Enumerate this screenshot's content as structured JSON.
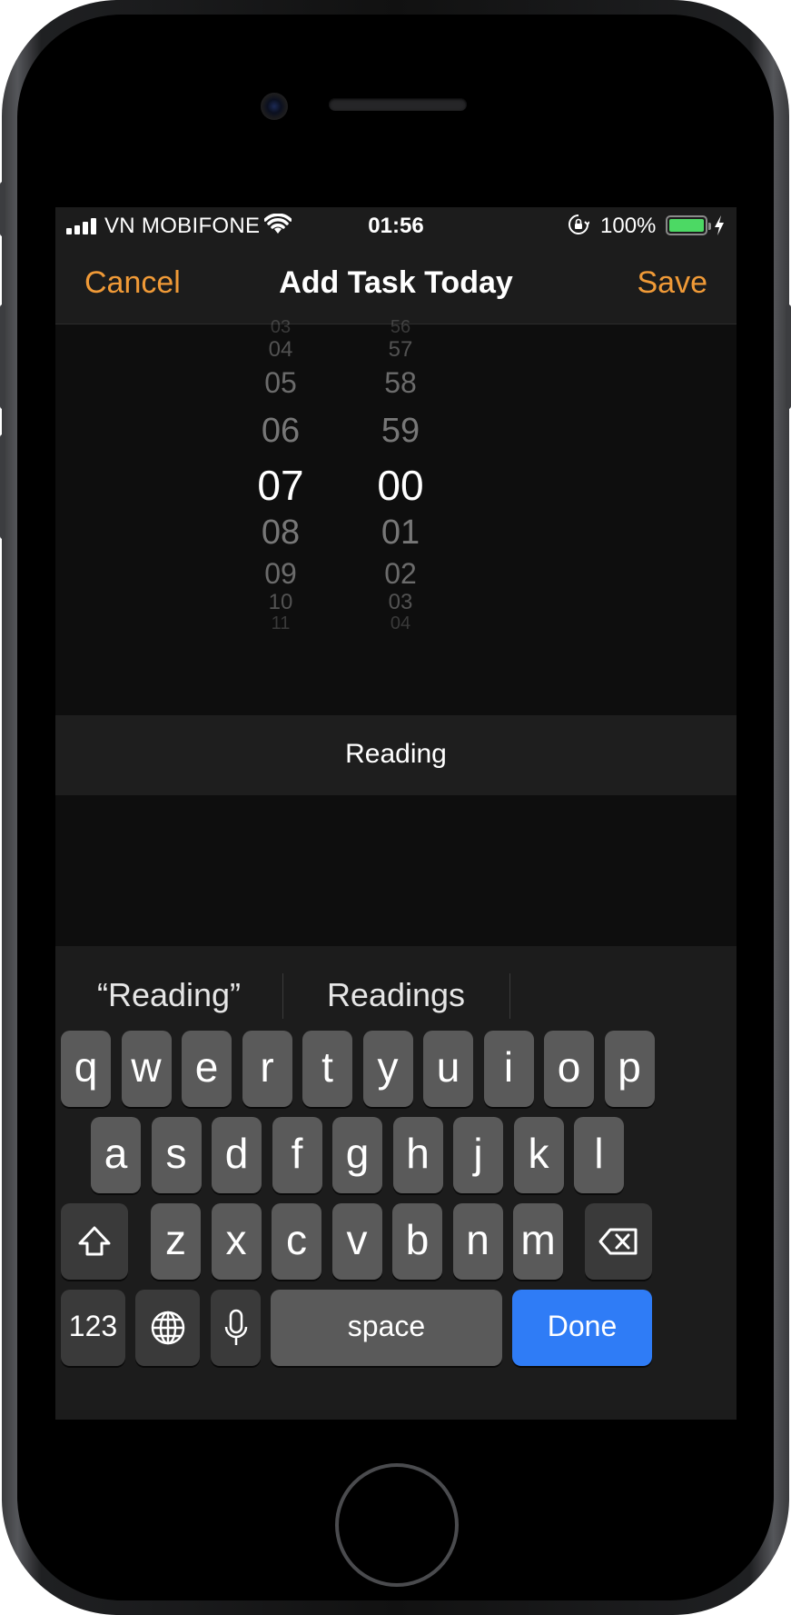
{
  "status_bar": {
    "carrier": "VN MOBIFONE",
    "time": "01:56",
    "battery_text": "100%",
    "battery_level": 1.0,
    "battery_color": "#4cd964",
    "icons": [
      "signal-icon",
      "wifi-icon",
      "orientation-lock-icon",
      "battery-icon",
      "charging-bolt-icon"
    ]
  },
  "nav": {
    "cancel": "Cancel",
    "title": "Add Task Today",
    "save": "Save",
    "accent": "#f09a37"
  },
  "picker": {
    "hours": [
      "03",
      "04",
      "05",
      "06",
      "07",
      "08",
      "09",
      "10",
      "11"
    ],
    "minutes": [
      "56",
      "57",
      "58",
      "59",
      "00",
      "01",
      "02",
      "03",
      "04"
    ],
    "selected_hour": "07",
    "selected_minute": "00"
  },
  "task": {
    "value": "Reading"
  },
  "suggestions": [
    "“Reading”",
    "Readings",
    ""
  ],
  "keyboard": {
    "row1": [
      "q",
      "w",
      "e",
      "r",
      "t",
      "y",
      "u",
      "i",
      "o",
      "p"
    ],
    "row2": [
      "a",
      "s",
      "d",
      "f",
      "g",
      "h",
      "j",
      "k",
      "l"
    ],
    "row3": [
      "z",
      "x",
      "c",
      "v",
      "b",
      "n",
      "m"
    ],
    "numbers_key": "123",
    "space_key": "space",
    "done_key": "Done",
    "done_color": "#2f7cf6",
    "icons": [
      "shift-icon",
      "backspace-icon",
      "globe-icon",
      "microphone-icon"
    ]
  }
}
